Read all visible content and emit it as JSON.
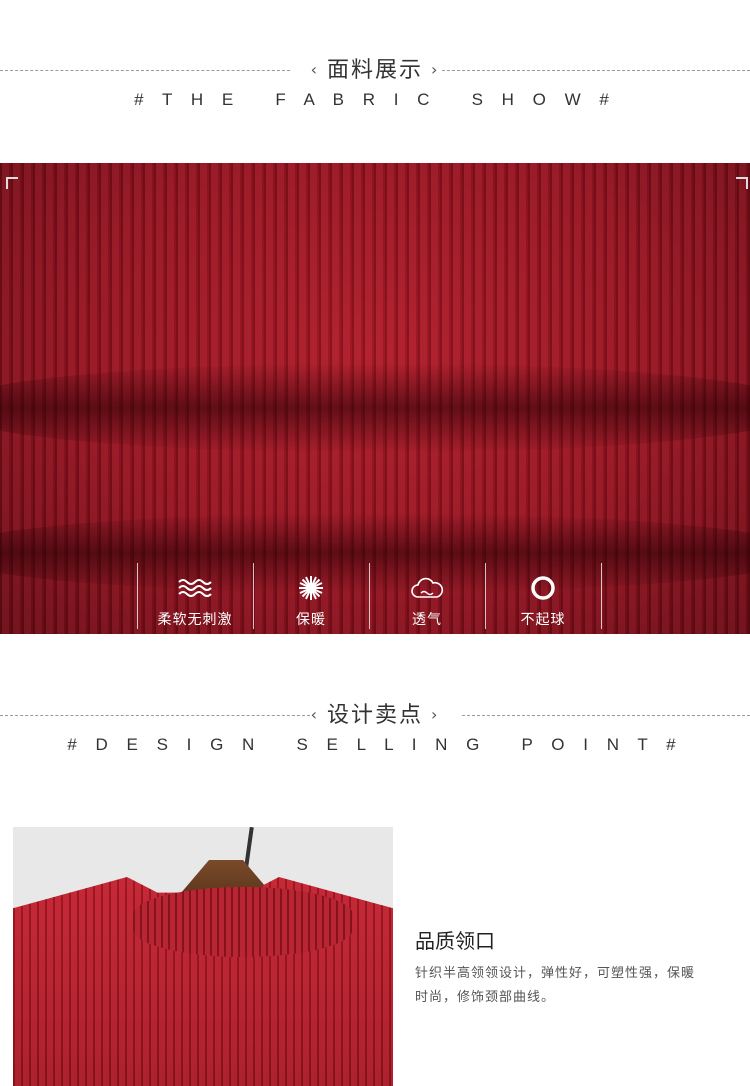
{
  "fabric_section": {
    "title_cn": "面料展示",
    "title_en": "# T H E   F A B R I C   S H O W #",
    "chevron_left": "‹",
    "chevron_right": "›"
  },
  "features": [
    {
      "icon": "waves-icon",
      "label": "柔软无刺激"
    },
    {
      "icon": "sun-icon",
      "label": "保暖"
    },
    {
      "icon": "cloud-icon",
      "label": "透气"
    },
    {
      "icon": "ring-icon",
      "label": "不起球"
    }
  ],
  "design_section": {
    "title_cn": "设计卖点",
    "title_en": "# D E S I G N   S E L L I N G   P O I N T #",
    "chevron_left": "‹",
    "chevron_right": "›"
  },
  "selling_point": {
    "title": "品质领口",
    "description": "针织半高领领设计，弹性好，可塑性强，保暖时尚，修饰颈部曲线。"
  },
  "colors": {
    "fabric_red": "#a3141f",
    "text_dark": "#333333",
    "white": "#ffffff"
  }
}
